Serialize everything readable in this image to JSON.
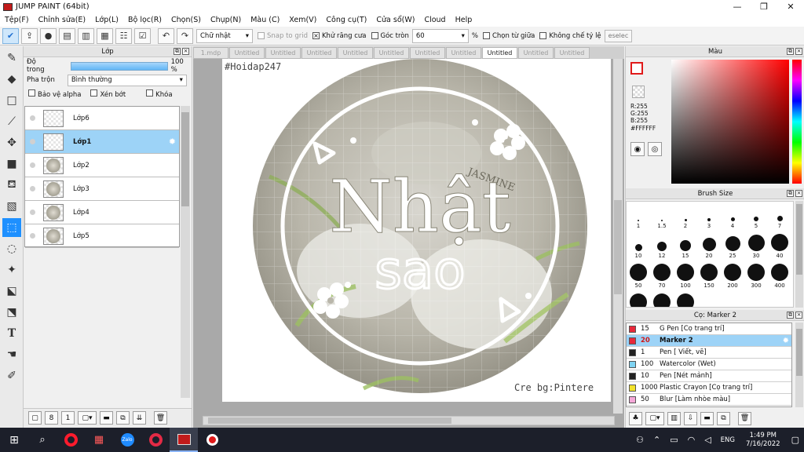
{
  "window": {
    "title": "JUMP PAINT (64bit)",
    "min_icon": "minimize-icon",
    "max_icon": "maximize-icon",
    "close_icon": "close-icon"
  },
  "menu": [
    "Tệp(F)",
    "Chỉnh sửa(E)",
    "Lớp(L)",
    "Bộ lọc(R)",
    "Chọn(S)",
    "Chụp(N)",
    "Màu (C)",
    "Xem(V)",
    "Công cụ(T)",
    "Cửa sổ(W)",
    "Cloud",
    "Help"
  ],
  "toolbar": {
    "shape_select": "Chữ nhật",
    "snap_to_grid": "Snap to grid",
    "antialias": "Khử răng cưa",
    "round_corner": "Góc tròn",
    "round_value": "60",
    "unit": "%",
    "select_center": "Chọn từ giữa",
    "no_ratio": "Không chế tỷ lệ",
    "deselect": "eselec",
    "antialias_checked": "×"
  },
  "layer_panel": {
    "title": "Lớp",
    "opacity_label": "Độ trong",
    "opacity_value": "100 %",
    "blend_label": "Pha trộn",
    "blend_value": "Bình thường",
    "opt_alpha": "Bảo vệ alpha",
    "opt_clip": "Xén bớt",
    "opt_lock": "Khóa",
    "layers": [
      {
        "name": "Lớp6",
        "selected": false
      },
      {
        "name": "Lớp1",
        "selected": true
      },
      {
        "name": "Lớp2",
        "selected": false
      },
      {
        "name": "Lớp3",
        "selected": false
      },
      {
        "name": "Lớp4",
        "selected": false
      },
      {
        "name": "Lớp5",
        "selected": false
      }
    ]
  },
  "tabs": [
    "1.mdp",
    "Untitled",
    "Untitled",
    "Untitled",
    "Untitled",
    "Untitled",
    "Untitled",
    "Untitled",
    "Untitled",
    "Untitled",
    "Untitled"
  ],
  "active_tab_index": 8,
  "canvas": {
    "hashtag": "#Hoidap247",
    "title_line1": "Nhật",
    "title_line2": "sao",
    "credit": "Cre bg:Pintere",
    "bg_text": "JASMINE"
  },
  "color_panel": {
    "title": "Màu",
    "r": "R:255",
    "g": "G:255",
    "b": "B:255",
    "hex": "#FFFFFF",
    "fg_color": "#e01a1a"
  },
  "brush_panel": {
    "title": "Brush Size",
    "sizes": [
      "1",
      "1.5",
      "2",
      "3",
      "4",
      "5",
      "7",
      "10",
      "12",
      "15",
      "20",
      "25",
      "30",
      "40",
      "50",
      "70",
      "100",
      "150",
      "200",
      "300",
      "400",
      "",
      "",
      ""
    ]
  },
  "tool_panel": {
    "title": "Cọ: Marker 2",
    "items": [
      {
        "size": "15",
        "name": "G Pen [Cọ trang trí]",
        "color": "#e8283a",
        "selected": false
      },
      {
        "size": "20",
        "name": "Marker 2",
        "color": "#e8283a",
        "selected": true
      },
      {
        "size": "1",
        "name": "Pen [ Viết, vẽ]",
        "color": "#222222",
        "selected": false
      },
      {
        "size": "100",
        "name": "Watercolor (Wet)",
        "color": "#7fd3f2",
        "selected": false
      },
      {
        "size": "10",
        "name": "Pen [Nét mảnh]",
        "color": "#222222",
        "selected": false
      },
      {
        "size": "1000",
        "name": "Plastic Crayon [Cọ trang trí]",
        "color": "#f2e22a",
        "selected": false
      },
      {
        "size": "50",
        "name": "Blur [Làm nhòe màu]",
        "color": "#f5a8d8",
        "selected": false
      }
    ]
  },
  "taskbar": {
    "lang": "ENG",
    "time": "1:49 PM",
    "date": "7/16/2022",
    "icons": [
      "search-icon",
      "opera-icon",
      "app-grid-icon",
      "zalo-icon",
      "opera-gx-icon",
      "jump-paint-icon",
      "record-icon"
    ],
    "zalo_label": "Zalo"
  }
}
